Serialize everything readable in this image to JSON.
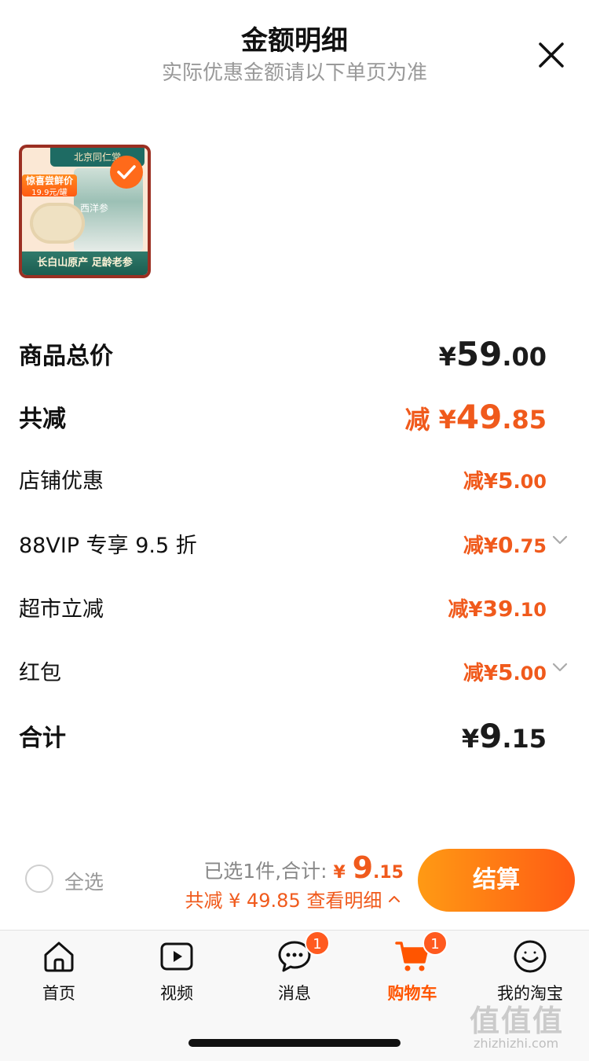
{
  "header": {
    "title": "金额明细",
    "subtitle": "实际优惠金额请以下单页为准",
    "close_icon": "close-icon"
  },
  "product": {
    "brand": "北京同仁堂",
    "flash_tag": "惊喜尝鲜价",
    "flash_price": "19.9元/罐",
    "can_label": "西洋参",
    "banner": "长白山原产  足龄老参",
    "selected": true,
    "check_icon": "check-icon"
  },
  "details": {
    "total": {
      "label": "商品总价",
      "cur": "¥",
      "int": "59",
      "dec": ".00"
    },
    "discount_sum": {
      "label": "共减",
      "prefix": "减 ",
      "cur": "¥",
      "int": "49",
      "dec": ".85"
    },
    "shop": {
      "label": "店铺优惠",
      "prefix": "减",
      "cur": "¥",
      "int": "5",
      "dec": ".00"
    },
    "vip": {
      "label": "88VIP 专享 9.5 折",
      "prefix": "减",
      "cur": "¥",
      "int": "0",
      "dec": ".75",
      "chevron_icon": "chevron-down-icon"
    },
    "market": {
      "label": "超市立减",
      "prefix": "减",
      "cur": "¥",
      "int": "39",
      "dec": ".10"
    },
    "redpacket": {
      "label": "红包",
      "prefix": "减",
      "cur": "¥",
      "int": "5",
      "dec": ".00",
      "chevron_icon": "chevron-down-icon"
    },
    "sum": {
      "label": "合计",
      "cur": "¥",
      "int": "9",
      "dec": ".15"
    }
  },
  "action_bar": {
    "select_all": "全选",
    "selected_text": "已选1件,合计:",
    "total_cur": "¥",
    "total_int": "9",
    "total_dec": ".15",
    "discount_text": "共减 ¥ 49.85",
    "detail_link": "查看明细",
    "chevron_up_icon": "chevron-up-icon",
    "checkout": "结算"
  },
  "tabbar": {
    "tabs": [
      {
        "label": "首页",
        "icon": "home-icon"
      },
      {
        "label": "视频",
        "icon": "video-icon"
      },
      {
        "label": "消息",
        "icon": "message-icon",
        "badge": "1"
      },
      {
        "label": "购物车",
        "icon": "cart-icon",
        "badge": "1",
        "active": true
      },
      {
        "label": "我的淘宝",
        "icon": "profile-icon"
      }
    ]
  },
  "watermark": {
    "text": "值值值",
    "url": "zhizhizhi.com"
  },
  "colors": {
    "accent": "#f05a1c",
    "button_start": "#ff9a14",
    "button_end": "#ff5b14"
  }
}
